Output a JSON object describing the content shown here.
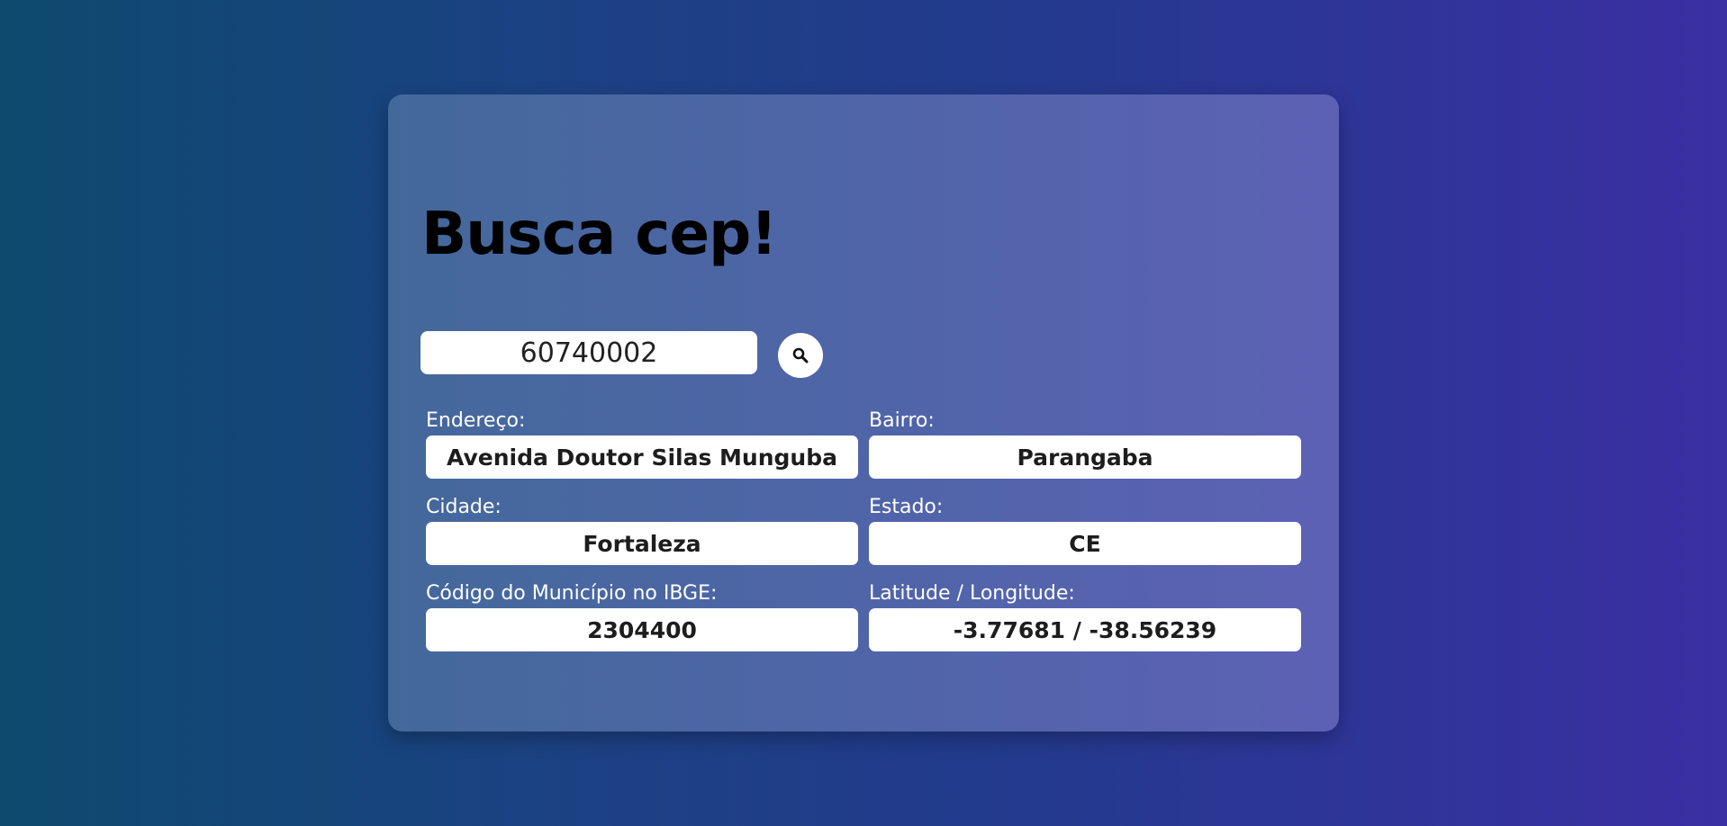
{
  "app": {
    "title": "Busca cep!"
  },
  "search": {
    "value": "60740002"
  },
  "icons": {
    "search_button": "search-icon"
  },
  "fields": {
    "endereco": {
      "label": "Endereço:",
      "value": "Avenida Doutor Silas Munguba"
    },
    "bairro": {
      "label": "Bairro:",
      "value": "Parangaba"
    },
    "cidade": {
      "label": "Cidade:",
      "value": "Fortaleza"
    },
    "estado": {
      "label": "Estado:",
      "value": "CE"
    },
    "ibge": {
      "label": "Código do Município no IBGE:",
      "value": "2304400"
    },
    "latlng": {
      "label": "Latitude / Longitude:",
      "value": "-3.77681 / -38.56239"
    }
  },
  "colors": {
    "background_start": "#0d4a6e",
    "background_end": "#3a2fa3",
    "field_background": "#ffffff",
    "title_text": "#000000",
    "label_text": "#ffffff"
  }
}
